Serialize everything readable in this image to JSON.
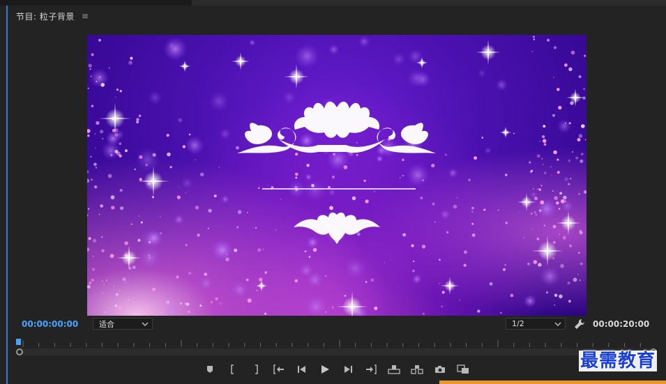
{
  "panel": {
    "title": "节目: 粒子背景",
    "menu_icon": "hamburger-icon"
  },
  "timecodes": {
    "current": "00:00:00:00",
    "duration": "00:00:20:00"
  },
  "zoom_select": {
    "value": "适合"
  },
  "resolution_select": {
    "value": "1/2"
  },
  "controls": [
    {
      "name": "add-marker-button",
      "icon": "marker-icon"
    },
    {
      "name": "mark-in-button",
      "icon": "mark-in-icon"
    },
    {
      "name": "mark-out-button",
      "icon": "mark-out-icon"
    },
    {
      "name": "go-to-in-button",
      "icon": "go-to-in-icon"
    },
    {
      "name": "step-back-button",
      "icon": "step-back-icon"
    },
    {
      "name": "play-button",
      "icon": "play-icon"
    },
    {
      "name": "step-forward-button",
      "icon": "step-forward-icon"
    },
    {
      "name": "go-to-out-button",
      "icon": "go-to-out-icon"
    },
    {
      "name": "lift-button",
      "icon": "lift-icon"
    },
    {
      "name": "extract-button",
      "icon": "extract-icon"
    },
    {
      "name": "export-frame-button",
      "icon": "camera-icon"
    },
    {
      "name": "comparison-view-button",
      "icon": "comparison-icon"
    }
  ],
  "watermark": "最需教育",
  "colors": {
    "accent_blue": "#4aa3ff",
    "background": "#232323",
    "watermark_blue": "#1a3fd8",
    "orange": "#e8982a"
  }
}
